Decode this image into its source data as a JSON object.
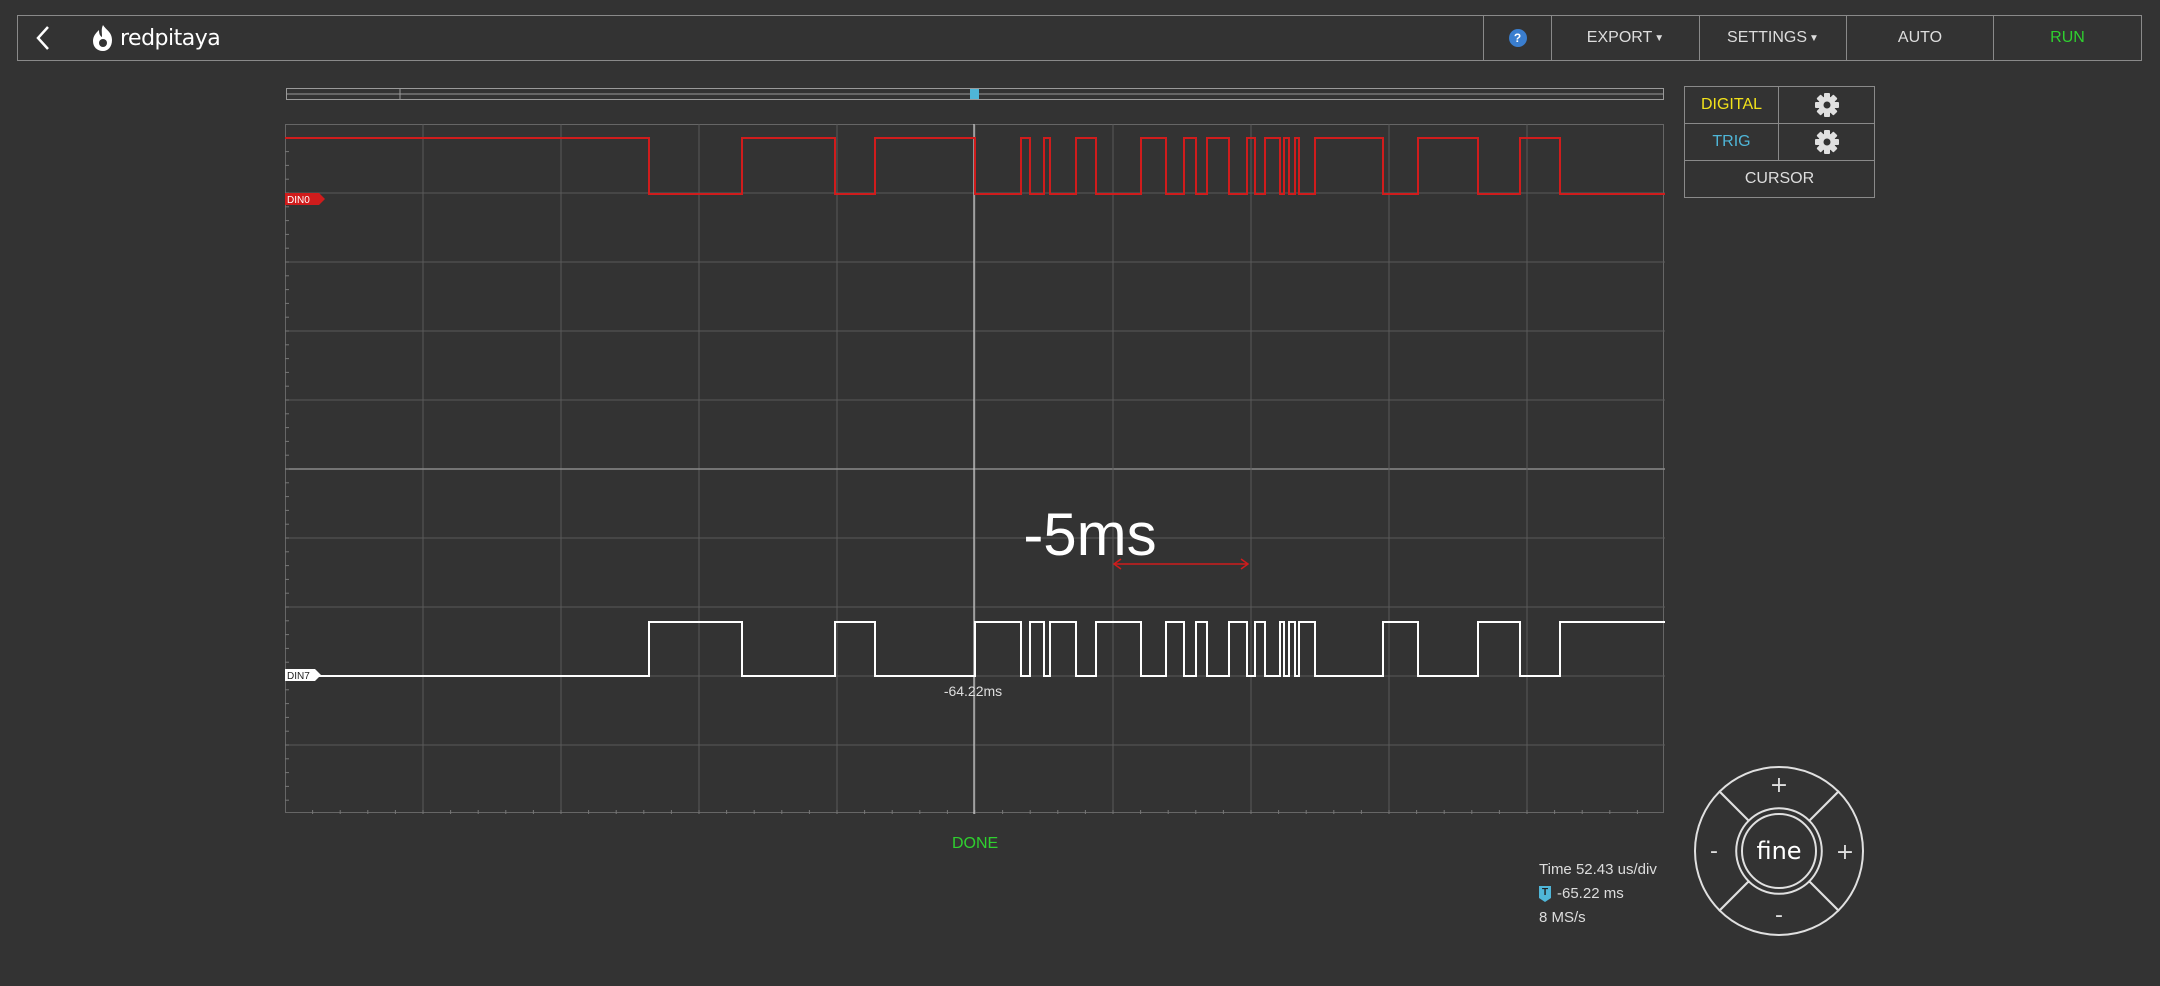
{
  "navbar": {
    "logo_text": "redpitaya",
    "help_label": "?",
    "export_label": "EXPORT",
    "settings_label": "SETTINGS",
    "auto_label": "AUTO",
    "run_label": "RUN"
  },
  "side_panel": {
    "digital_label": "DIGITAL",
    "trig_label": "TRIG",
    "cursor_label": "CURSOR"
  },
  "graph": {
    "channel0_label": "DIN0",
    "channel7_label": "DIN7",
    "cursor_delta": "-5ms",
    "trigger_time": "-64.22ms"
  },
  "status": {
    "state": "DONE",
    "time_scale": "Time 52.43 us/div",
    "trigger_badge": "T",
    "trigger_offset": "-65.22 ms",
    "sample_rate": "8 MS/s"
  },
  "joystick": {
    "center_label": "fine",
    "up_label": "+",
    "down_label": "-",
    "left_label": "-",
    "right_label": "+"
  },
  "colors": {
    "background": "#333333",
    "din0": "#d01c1c",
    "din7": "#ffffff",
    "digital": "#f2e21a",
    "trig": "#4fb6d8",
    "run": "#2fd02f",
    "done": "#2fd02f"
  },
  "icons": {
    "back": "chevron-left-icon",
    "help": "help-icon",
    "settings": "gear-icon"
  }
}
